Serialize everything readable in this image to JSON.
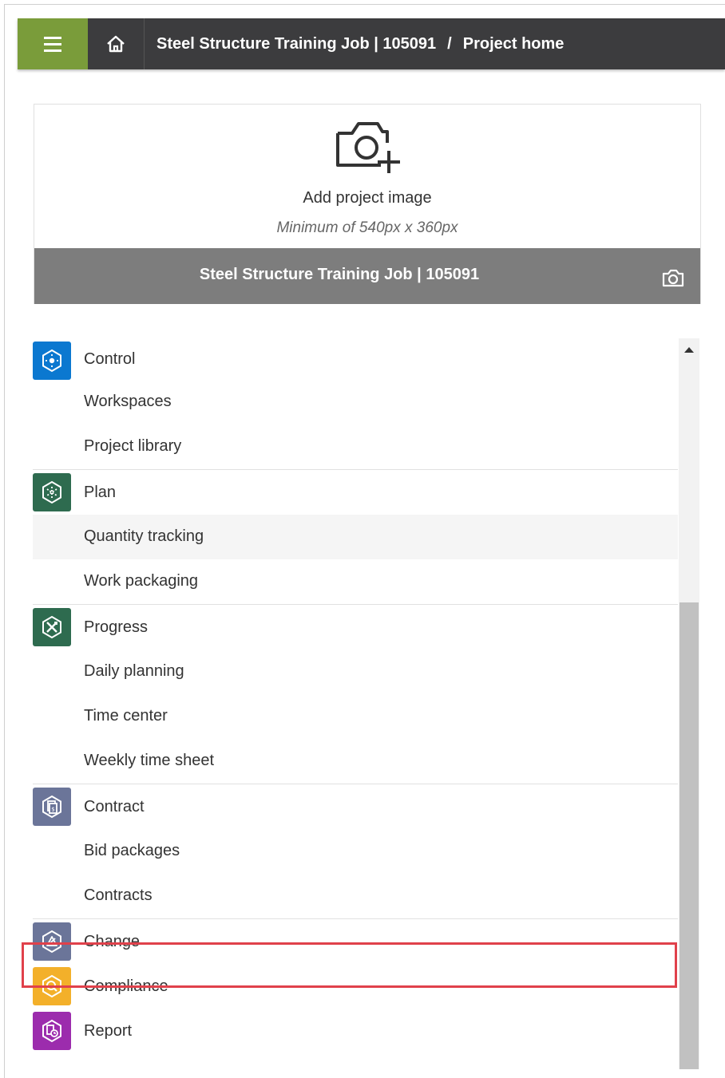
{
  "header": {
    "menu_icon": "hamburger-icon",
    "home_icon": "home-icon",
    "breadcrumb": {
      "project": "Steel Structure Training Job | 105091",
      "separator": "/",
      "page": "Project home"
    }
  },
  "project_image": {
    "add_icon": "camera-add-icon",
    "add_label": "Add project image",
    "min_size": "Minimum of 540px x 360px",
    "project_name": "Steel Structure Training Job | 105091",
    "camera_icon": "camera-icon"
  },
  "colors": {
    "menu_button": "#7a9c3a",
    "topbar": "#3c3c3e",
    "control": "#0b78d0",
    "plan": "#2e6b4f",
    "progress": "#2e6b4f",
    "contract": "#6b7599",
    "change": "#6b7599",
    "compliance": "#f3b02a",
    "report": "#9c2cad",
    "highlight": "#e0414b"
  },
  "menu": {
    "sections": [
      {
        "title": "Control",
        "icon": "control-icon",
        "items": [
          "Workspaces",
          "Project library"
        ]
      },
      {
        "title": "Plan",
        "icon": "plan-icon",
        "items": [
          "Quantity tracking",
          "Work packaging"
        ]
      },
      {
        "title": "Progress",
        "icon": "progress-icon",
        "items": [
          "Daily planning",
          "Time center",
          "Weekly time sheet"
        ]
      },
      {
        "title": "Contract",
        "icon": "contract-icon",
        "items": [
          "Bid packages",
          "Contracts"
        ]
      },
      {
        "title": "Change",
        "icon": "change-icon",
        "items": [],
        "highlighted": true
      },
      {
        "title": "Compliance",
        "icon": "compliance-icon",
        "items": []
      },
      {
        "title": "Report",
        "icon": "report-icon",
        "items": []
      }
    ]
  }
}
